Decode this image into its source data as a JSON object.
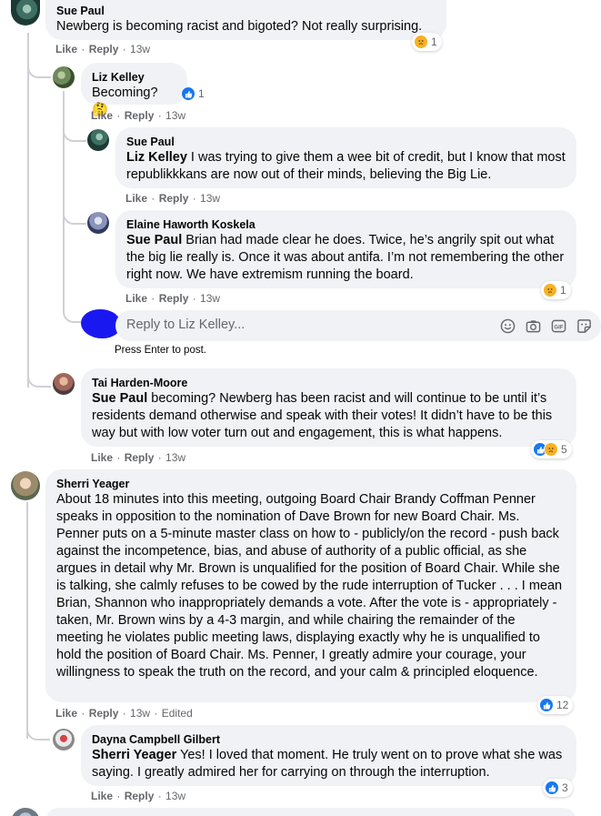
{
  "comments": [
    {
      "author": "Sue Paul",
      "text": "Newberg is becoming racist and bigoted? Not really surprising.",
      "like": "Like",
      "reply": "Reply",
      "time": "13w",
      "reaction_count": "1"
    },
    {
      "author": "Liz Kelley",
      "text": "Becoming? 🤔",
      "like": "Like",
      "reply": "Reply",
      "time": "13w",
      "reaction_count": "1"
    },
    {
      "author": "Sue Paul",
      "mention": "Liz Kelley",
      "text": " I was trying to give them a wee bit of credit, but I know that most republikkkans are now out of their minds, believing the Big Lie.",
      "like": "Like",
      "reply": "Reply",
      "time": "13w"
    },
    {
      "author": "Elaine Haworth Koskela",
      "mention": "Sue Paul",
      "text": " Brian had made clear he does. Twice, he’s angrily spit out what the big lie really is. Once it was about antifa. I’m not remembering the other right now. We have extremism running the board.",
      "like": "Like",
      "reply": "Reply",
      "time": "13w",
      "reaction_count": "1"
    },
    {
      "author": "Tai Harden-Moore",
      "mention": "Sue Paul",
      "text": " becoming? Newberg has been racist and will continue to be until it’s residents demand otherwise and speak with their votes! It didn’t have to be this way but with low voter turn out and engagement, this is what happens.",
      "like": "Like",
      "reply": "Reply",
      "time": "13w",
      "reaction_count": "5"
    },
    {
      "author": "Sherri Yeager",
      "text": "About 18 minutes into this meeting, outgoing Board Chair Brandy Coffman Penner speaks in opposition to the nomination of Dave Brown for new Board Chair. Ms. Penner puts on a 5-minute master class on how to - publicly/on the record - push back against the incompetence, bias, and abuse of authority of a public official, as she argues in detail why Mr. Brown is unqualified for the position of Board Chair. While she is talking, she calmly refuses to be cowed by the rude interruption of Tucker . . . I mean Brian, Shannon who inappropriately demands a vote. After the vote is - appropriately - taken, Mr. Brown wins by a 4-3 margin, and while chairing the remainder of the meeting he violates public meeting laws, displaying exactly why he is unqualified to hold the position of Board Chair. Ms. Penner, I greatly admire your courage, your willingness to speak the truth on the record, and your calm & principled eloquence.",
      "like": "Like",
      "reply": "Reply",
      "time": "13w",
      "edited": "Edited",
      "reaction_count": "12"
    },
    {
      "author": "Dayna Campbell Gilbert",
      "mention": "Sherri Yeager",
      "text": " Yes! I loved that moment. He truly went on to prove what she was saying. I greatly admired her for carrying on through the interruption.",
      "like": "Like",
      "reply": "Reply",
      "time": "13w",
      "reaction_count": "3"
    }
  ],
  "reply_box": {
    "placeholder": "Reply to Liz Kelley...",
    "hint": "Press Enter to post."
  },
  "icons": [
    "emoji-icon",
    "camera-icon",
    "gif-icon",
    "sticker-icon",
    "like-icon",
    "sad-icon"
  ],
  "colors": {
    "bubble": "#f0f2f5",
    "like_blue": "#1877f2",
    "sad_yellow": "#f7b125",
    "meta_gray": "#65676b"
  }
}
